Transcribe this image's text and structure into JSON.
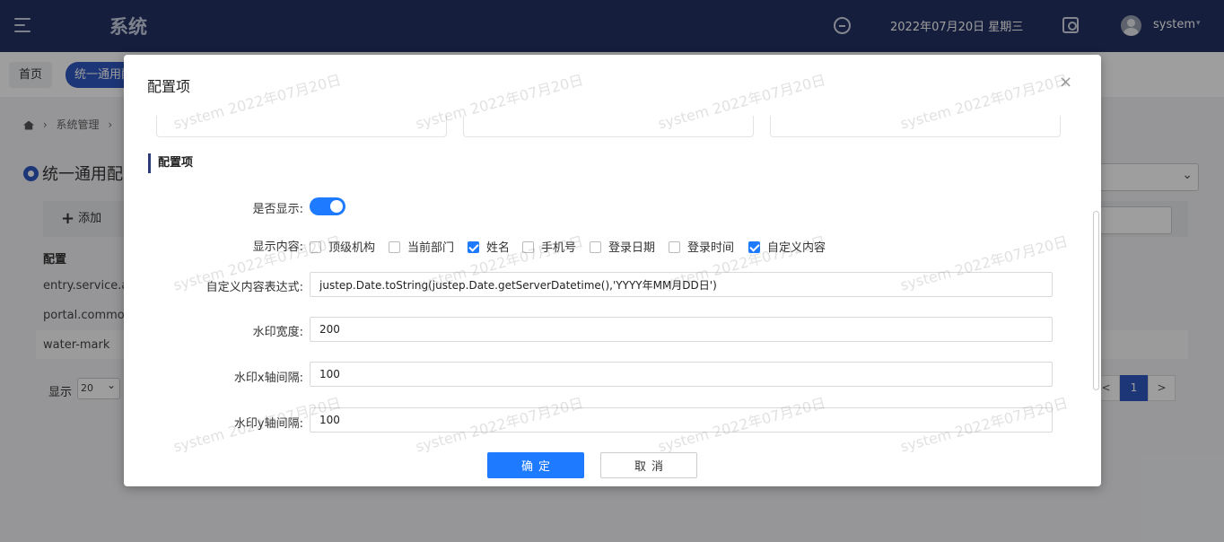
{
  "header": {
    "app_title": "系统",
    "date_text": "2022年07月20日 星期三",
    "user_name": "system",
    "user_caret": "▾"
  },
  "tabs": {
    "home": "首页",
    "active": "统一通用配置"
  },
  "background": {
    "breadcrumb_root": "系统管理",
    "breadcrumb_sep": "›",
    "page_title": "统一通用配置",
    "add_label": "添加",
    "add_plus": "+",
    "col_header": "配置",
    "rows": [
      "entry.service.agent",
      "portal.common",
      "water-mark"
    ],
    "pager_show": "显示",
    "pager_size": "20",
    "pager_prev": "<",
    "pager_current": "1",
    "pager_next": ">"
  },
  "modal": {
    "title": "配置项",
    "close": "×",
    "section_title": "配置项",
    "show_label": "是否显示:",
    "show_on": true,
    "content_label": "显示内容:",
    "checkboxes": [
      {
        "label": "顶级机构",
        "checked": false
      },
      {
        "label": "当前部门",
        "checked": false
      },
      {
        "label": "姓名",
        "checked": true
      },
      {
        "label": "手机号",
        "checked": false
      },
      {
        "label": "登录日期",
        "checked": false
      },
      {
        "label": "登录时间",
        "checked": false
      },
      {
        "label": "自定义内容",
        "checked": true
      }
    ],
    "expr_label": "自定义内容表达式:",
    "expr_value": "justep.Date.toString(justep.Date.getServerDatetime(),'YYYY年MM月DD日')",
    "width_label": "水印宽度:",
    "width_value": "200",
    "xgap_label": "水印x轴间隔:",
    "xgap_value": "100",
    "ygap_label": "水印y轴间隔:",
    "ygap_value": "100",
    "ok_label": "确定",
    "cancel_label": "取消"
  },
  "watermark_text": "system 2022年07月20日",
  "colors": {
    "header_bg": "#223263",
    "accent": "#1e7bff",
    "tab_active": "#2f57c1"
  }
}
